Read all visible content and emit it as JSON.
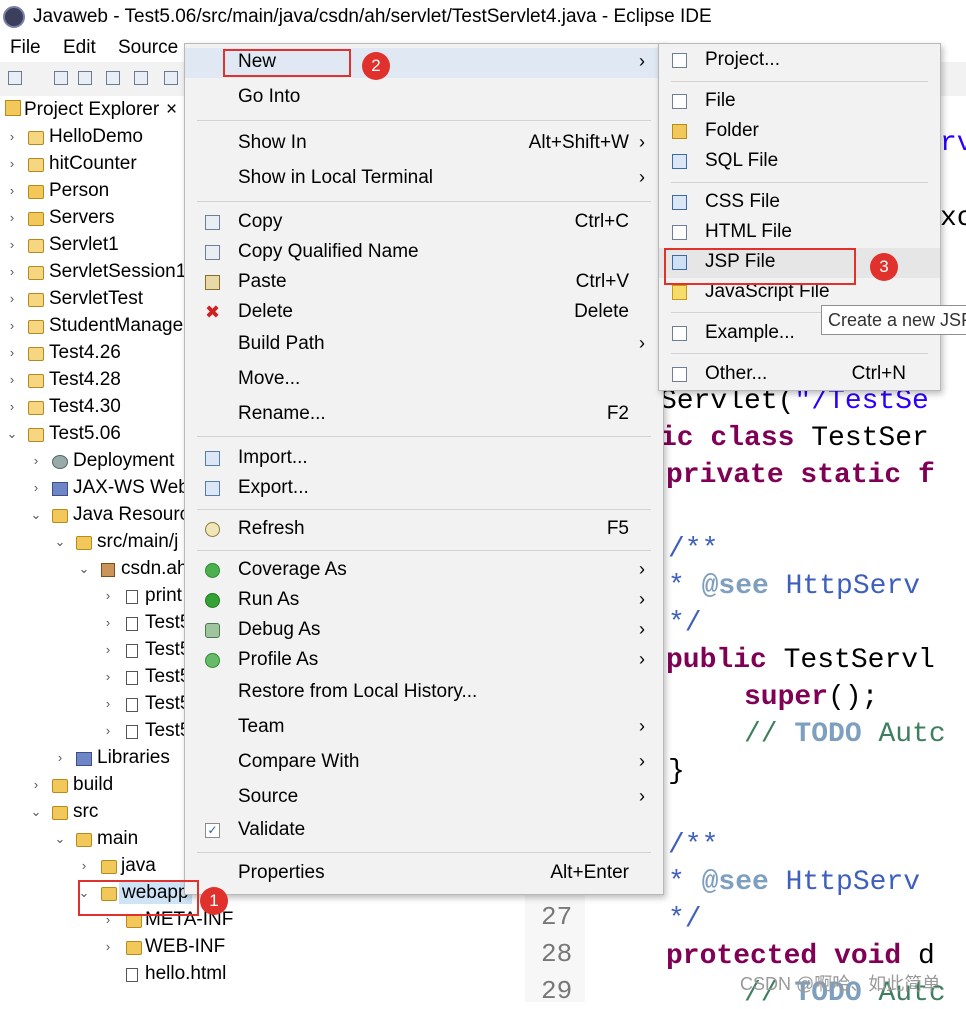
{
  "window": {
    "title": "Javaweb - Test5.06/src/main/java/csdn/ah/servlet/TestServlet4.java - Eclipse IDE"
  },
  "menubar": {
    "file": "File",
    "edit": "Edit",
    "source": "Source"
  },
  "explorer": {
    "tab_label": "Project Explorer",
    "items": [
      "HelloDemo",
      "hitCounter",
      "Person",
      "Servers",
      "Servlet1",
      "ServletSession1",
      "ServletTest",
      "StudentManage",
      "Test4.26",
      "Test4.28",
      "Test4.30",
      "Test5.06",
      "Deployment",
      "JAX-WS Web",
      "Java Resourc",
      "src/main/j",
      "csdn.ah",
      "print",
      "Test5",
      "Test5",
      "Test5",
      "Test5",
      "Test5",
      "Libraries",
      "build",
      "src",
      "main",
      "java",
      "webapp",
      "META-INF",
      "WEB-INF",
      "hello.html"
    ]
  },
  "context_menu": {
    "new": "New",
    "go_into": "Go Into",
    "show_in": "Show In",
    "show_in_shortcut": "Alt+Shift+W",
    "show_local_terminal": "Show in Local Terminal",
    "copy": "Copy",
    "copy_shortcut": "Ctrl+C",
    "copy_qualified": "Copy Qualified Name",
    "paste": "Paste",
    "paste_shortcut": "Ctrl+V",
    "delete": "Delete",
    "delete_shortcut": "Delete",
    "build_path": "Build Path",
    "move": "Move...",
    "rename": "Rename...",
    "rename_shortcut": "F2",
    "import": "Import...",
    "export": "Export...",
    "refresh": "Refresh",
    "refresh_shortcut": "F5",
    "coverage_as": "Coverage As",
    "run_as": "Run As",
    "debug_as": "Debug As",
    "profile_as": "Profile As",
    "restore_history": "Restore from Local History...",
    "team": "Team",
    "compare_with": "Compare With",
    "source": "Source",
    "validate": "Validate",
    "properties": "Properties",
    "properties_shortcut": "Alt+Enter"
  },
  "submenu": {
    "project": "Project...",
    "file": "File",
    "folder": "Folder",
    "sql_file": "SQL File",
    "css_file": "CSS File",
    "html_file": "HTML File",
    "jsp_file": "JSP File",
    "js_file": "JavaScript File",
    "example": "Example...",
    "other": "Other...",
    "other_shortcut": "Ctrl+N"
  },
  "tooltip": "Create a new JSP",
  "badges": {
    "one": "1",
    "two": "2",
    "three": "3"
  },
  "editor": {
    "line_27": "27",
    "line_28": "28",
    "line_29": "29"
  },
  "watermark": "CSDN @啊哈、如此简单",
  "colors": {
    "annotation_red": "#e0312c",
    "keyword": "#7f0055",
    "string": "#2a00ff"
  }
}
